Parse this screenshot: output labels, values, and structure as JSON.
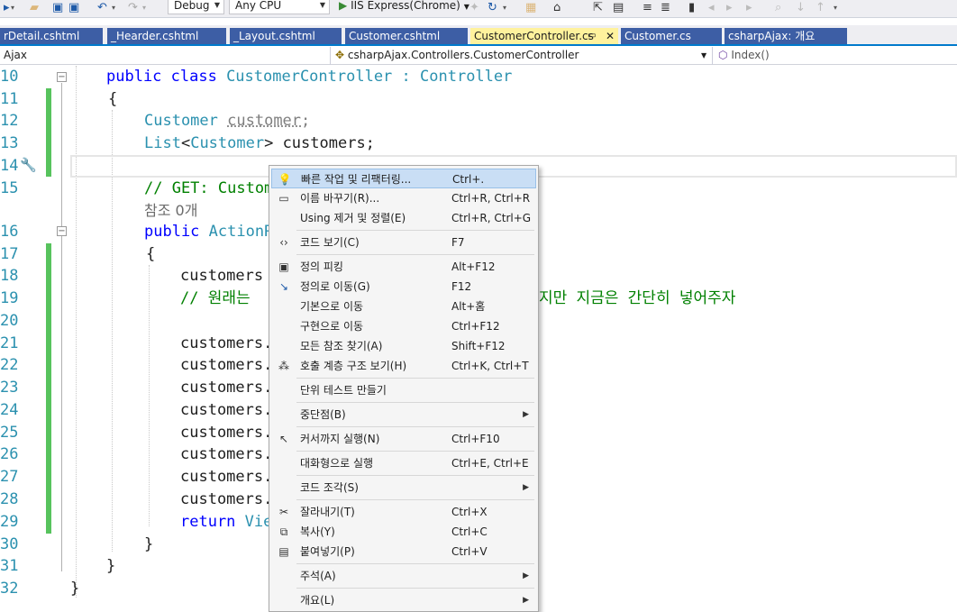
{
  "toolbar": {
    "config": "Debug",
    "platform": "Any CPU",
    "run_target": "IIS Express(Chrome)"
  },
  "tabs": [
    {
      "label": "rDetail.cshtml"
    },
    {
      "label": "_Hearder.cshtml"
    },
    {
      "label": "_Layout.cshtml"
    },
    {
      "label": "Customer.cshtml"
    },
    {
      "label": "CustomerController.cs",
      "active": true
    },
    {
      "label": "Customer.cs"
    },
    {
      "label": "csharpAjax: 개요"
    }
  ],
  "navbar": {
    "project": "Ajax",
    "type": "csharpAjax.Controllers.CustomerController",
    "member": "Index()"
  },
  "lines": {
    "n10": "10",
    "n11": "11",
    "n12": "12",
    "n13": "13",
    "n14": "14",
    "n15": "15",
    "n16": "16",
    "n17": "17",
    "n18": "18",
    "n19": "19",
    "n20": "20",
    "n21": "21",
    "n22": "22",
    "n23": "23",
    "n24": "24",
    "n25": "25",
    "n26": "26",
    "n27": "27",
    "n28": "28",
    "n29": "29",
    "n30": "30",
    "n31": "31",
    "n32": "32"
  },
  "code": {
    "l10_kw": "public class ",
    "l10_ty": "CustomerController",
    "l10_mid": " : ",
    "l10_base": "Controller",
    "l11": "{",
    "l12_ty": "Customer",
    "l12_var": "customer",
    "l12_end": ";",
    "l13_ty1": "List",
    "l13_lt": "<",
    "l13_ty2": "Customer",
    "l13_rest": "> customers;",
    "l15_cm": "// GET: Custom",
    "ref_count": "참조 0개",
    "l16_kw": "public ",
    "l16_ty": "ActionR",
    "l17": "{",
    "l18": "customers",
    "l19_cm": "// 원래는",
    "l19_cm_tail": "지만 지금은 간단히 넣어주자",
    "l21": "customers.",
    "l22": "customers.",
    "l23": "customers.",
    "l24": "customers.",
    "l25": "customers.",
    "l26": "customers.",
    "l27": "customers.",
    "l28": "customers.",
    "l29_kw": "return ",
    "l29_rest": "Vie",
    "l30": "}",
    "l31": "}",
    "l32": "}"
  },
  "context_menu": {
    "items": [
      {
        "label": "빠른 작업 및 리팩터링...",
        "shortcut": "Ctrl+.",
        "icon": "lightbulb-icon"
      },
      {
        "label": "이름 바꾸기(R)...",
        "shortcut": "Ctrl+R, Ctrl+R",
        "icon": "rename-icon"
      },
      {
        "label": "Using 제거 및 정렬(E)",
        "shortcut": "Ctrl+R, Ctrl+G",
        "icon": ""
      },
      {
        "label": "코드 보기(C)",
        "shortcut": "F7",
        "icon": "code-view-icon"
      },
      {
        "label": "정의 피킹",
        "shortcut": "Alt+F12",
        "icon": "peek-definition-icon"
      },
      {
        "label": "정의로 이동(G)",
        "shortcut": "F12",
        "icon": "go-to-definition-icon"
      },
      {
        "label": "기본으로 이동",
        "shortcut": "Alt+홈",
        "icon": ""
      },
      {
        "label": "구현으로 이동",
        "shortcut": "Ctrl+F12",
        "icon": ""
      },
      {
        "label": "모든 참조 찾기(A)",
        "shortcut": "Shift+F12",
        "icon": ""
      },
      {
        "label": "호출 계층 구조 보기(H)",
        "shortcut": "Ctrl+K, Ctrl+T",
        "icon": "call-hierarchy-icon"
      },
      {
        "label": "단위 테스트 만들기",
        "shortcut": "",
        "icon": ""
      },
      {
        "label": "중단점(B)",
        "shortcut": "",
        "icon": ""
      },
      {
        "label": "커서까지 실행(N)",
        "shortcut": "Ctrl+F10",
        "icon": "run-to-cursor-icon"
      },
      {
        "label": "대화형으로 실행",
        "shortcut": "Ctrl+E, Ctrl+E",
        "icon": ""
      },
      {
        "label": "코드 조각(S)",
        "shortcut": "",
        "icon": ""
      },
      {
        "label": "잘라내기(T)",
        "shortcut": "Ctrl+X",
        "icon": "cut-icon"
      },
      {
        "label": "복사(Y)",
        "shortcut": "Ctrl+C",
        "icon": "copy-icon"
      },
      {
        "label": "붙여넣기(P)",
        "shortcut": "Ctrl+V",
        "icon": "paste-icon"
      },
      {
        "label": "주석(A)",
        "shortcut": "",
        "icon": ""
      },
      {
        "label": "개요(L)",
        "shortcut": "",
        "icon": ""
      }
    ]
  },
  "colors": {
    "keyword": "#0000ff",
    "type": "#2b91af",
    "comment": "#008000",
    "menu_highlight": "#c9def5",
    "active_tab": "#fff29d",
    "tab": "#3d5ea5",
    "change_bar": "#57c35d"
  }
}
